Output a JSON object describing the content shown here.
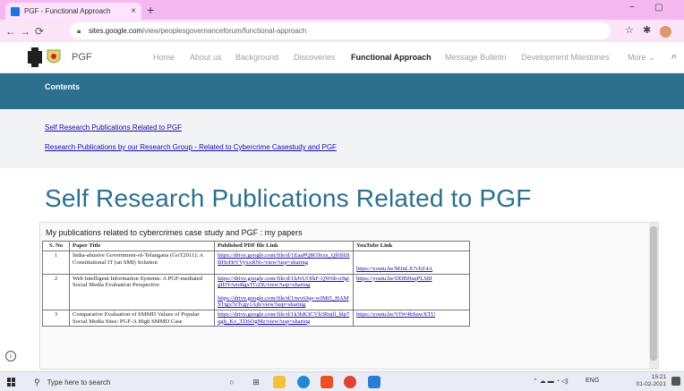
{
  "browser": {
    "tab_title": "PGF - Functional Approach",
    "tab_close": "×",
    "new_tab": "+",
    "minimize": "−",
    "maximize": "▢",
    "url_host": "sites.google.com",
    "url_path": "/view/peoplesgovernanceforum/functional-approach"
  },
  "site": {
    "name": "PGF",
    "nav": [
      "Home",
      "About us",
      "Background",
      "Discoveries",
      "Functional Approach",
      "Message Bulletin",
      "Development Milestones",
      "More"
    ],
    "active_nav": "Functional Approach"
  },
  "contents": {
    "title": "Contents",
    "links": [
      "Self Research Publications Related to PGF",
      "Research Publications by our Research Group - Related to Cybercrime Casestudy and PGF"
    ]
  },
  "section": {
    "heading": "Self Research Publications Related to PGF"
  },
  "doc": {
    "heading": "My publications related to cybercrimes case study and PGF : my papers",
    "columns": [
      "S. No",
      "Paper Title",
      "Published PDF file Link",
      "YouTube Link"
    ],
    "rows": [
      {
        "no": "1",
        "title": "India-abusive Government-of-Telangana (GoT2011): A Constitutional IT (an SMI) Solution",
        "pdf": [
          "https://drive.google.com/file/d/1EaaPQ8OJxxs_Ql6SliSBHoHrVVyxxRNt-/view?usp=sharing"
        ],
        "youtube": "https://youtu.be/MJnLX7cbZ4A"
      },
      {
        "no": "2",
        "title": "Web Intelligent Information Systems: A PGF-mediated Social Media Evaluation Perspective",
        "pdf": [
          "https://drive.google.com/file/d/1hJvUOfkF-QW6b-o9gigIDYAm4lgxTGZK/view?usp=sharing",
          "https://drive.google.com/file/d/1iwv6Jqe-wJMi5_HAMSTigx7eTcgy1Ajh/view?usp=sharing"
        ],
        "youtube": "https://youtu.be/DDBHsqPLS8I"
      },
      {
        "no": "3",
        "title": "Comparative Evaluation of SMMD Values of Popular Social Media Sites: PGF-A High SMMD Case",
        "pdf": [
          "https://drive.google.com/file/d/1k3hK3CVh3Rnjll_hlp7qgh_Kv_TD6OgMz/view?usp=sharing"
        ],
        "youtube": "https://youtu.be/VfW4bSuwXTU"
      }
    ]
  },
  "taskbar": {
    "search_placeholder": "Type here to search",
    "lang": "ENG",
    "time": "15:21",
    "date": "01-02-2021"
  }
}
